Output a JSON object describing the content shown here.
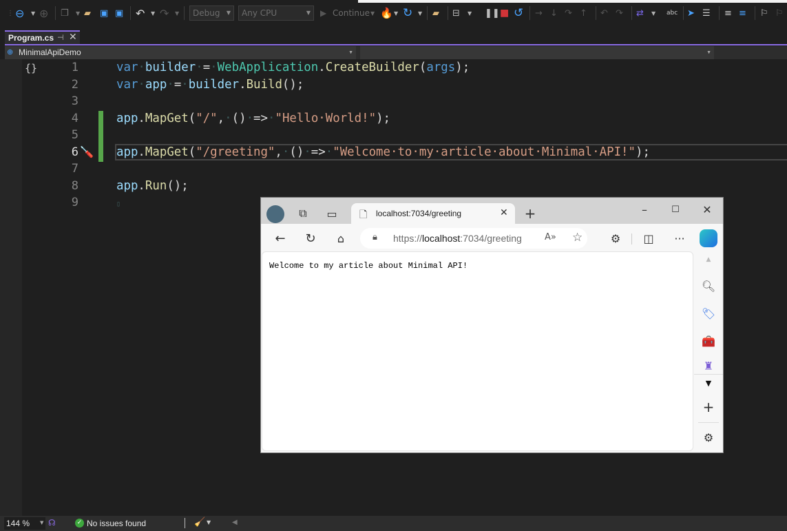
{
  "toolbar": {
    "config": "Debug",
    "platform": "Any CPU",
    "continue_label": "Continue",
    "icons": [
      "back-icon",
      "forward-icon",
      "new-project-icon",
      "open-folder-icon",
      "save-icon",
      "save-all-icon",
      "undo-icon",
      "redo-icon",
      "hot-reload-icon",
      "restart-icon",
      "browse-folder-icon",
      "browser-window-icon",
      "pause-icon",
      "stop-icon",
      "restart-debug-icon",
      "step-over-icon",
      "step-into-icon",
      "step-out-icon",
      "step-up-icon",
      "back-step-icon",
      "forward-step-icon",
      "live-share-icon",
      "spell-check-icon",
      "select-icon",
      "toggle-icon",
      "indent-icon",
      "unindent-icon",
      "bookmark-icon",
      "bookmark-prev-icon"
    ]
  },
  "tab": {
    "title": "Program.cs",
    "pin": "⊣",
    "close": "✕"
  },
  "navbar": {
    "project": "MinimalApiDemo",
    "member": ""
  },
  "editor": {
    "lines": [
      {
        "n": "1",
        "tokens": [
          [
            "kw",
            "var"
          ],
          [
            "ws",
            "·"
          ],
          [
            "id",
            "builder"
          ],
          [
            "ws",
            "·"
          ],
          [
            "pn",
            "="
          ],
          [
            "ws",
            "·"
          ],
          [
            "ty",
            "WebApplication"
          ],
          [
            "pn",
            "."
          ],
          [
            "fn",
            "CreateBuilder"
          ],
          [
            "pn",
            "("
          ],
          [
            "kw",
            "args"
          ],
          [
            "pn",
            ");"
          ]
        ]
      },
      {
        "n": "2",
        "tokens": [
          [
            "kw",
            "var"
          ],
          [
            "ws",
            "·"
          ],
          [
            "id",
            "app"
          ],
          [
            "ws",
            "·"
          ],
          [
            "pn",
            "="
          ],
          [
            "ws",
            "·"
          ],
          [
            "id",
            "builder"
          ],
          [
            "pn",
            "."
          ],
          [
            "fn",
            "Build"
          ],
          [
            "pn",
            "();"
          ]
        ]
      },
      {
        "n": "3",
        "tokens": []
      },
      {
        "n": "4",
        "tokens": [
          [
            "id",
            "app"
          ],
          [
            "pn",
            "."
          ],
          [
            "fn",
            "MapGet"
          ],
          [
            "pn",
            "("
          ],
          [
            "st",
            "\"/\""
          ],
          [
            "pn",
            ","
          ],
          [
            "ws",
            "·"
          ],
          [
            "pn",
            "()"
          ],
          [
            "ws",
            "·"
          ],
          [
            "pn",
            "=>"
          ],
          [
            "ws",
            "·"
          ],
          [
            "st",
            "\"Hello·World!\""
          ],
          [
            "pn",
            ");"
          ]
        ]
      },
      {
        "n": "5",
        "tokens": []
      },
      {
        "n": "6",
        "tokens": [
          [
            "id",
            "app"
          ],
          [
            "pn",
            "."
          ],
          [
            "fn",
            "MapGet"
          ],
          [
            "pn",
            "("
          ],
          [
            "st",
            "\"/greeting\""
          ],
          [
            "pn",
            ","
          ],
          [
            "ws",
            "·"
          ],
          [
            "pn",
            "()"
          ],
          [
            "ws",
            "·"
          ],
          [
            "pn",
            "=>"
          ],
          [
            "ws",
            "·"
          ],
          [
            "st",
            "\"Welcome·to·my·article·about·Minimal·API!\""
          ],
          [
            "pn",
            ");"
          ]
        ]
      },
      {
        "n": "7",
        "tokens": []
      },
      {
        "n": "8",
        "tokens": [
          [
            "id",
            "app"
          ],
          [
            "pn",
            "."
          ],
          [
            "fn",
            "Run"
          ],
          [
            "pn",
            "();"
          ]
        ]
      },
      {
        "n": "9",
        "tokens": []
      }
    ],
    "current_line": "6"
  },
  "browser": {
    "tab_title": "localhost:7034/greeting",
    "url_prefix": "https://",
    "url_host": "localhost",
    "url_rest": ":7034/greeting",
    "page_text": "Welcome to my article about Minimal API!"
  },
  "status": {
    "zoom": "144 %",
    "issues": "No issues found"
  }
}
